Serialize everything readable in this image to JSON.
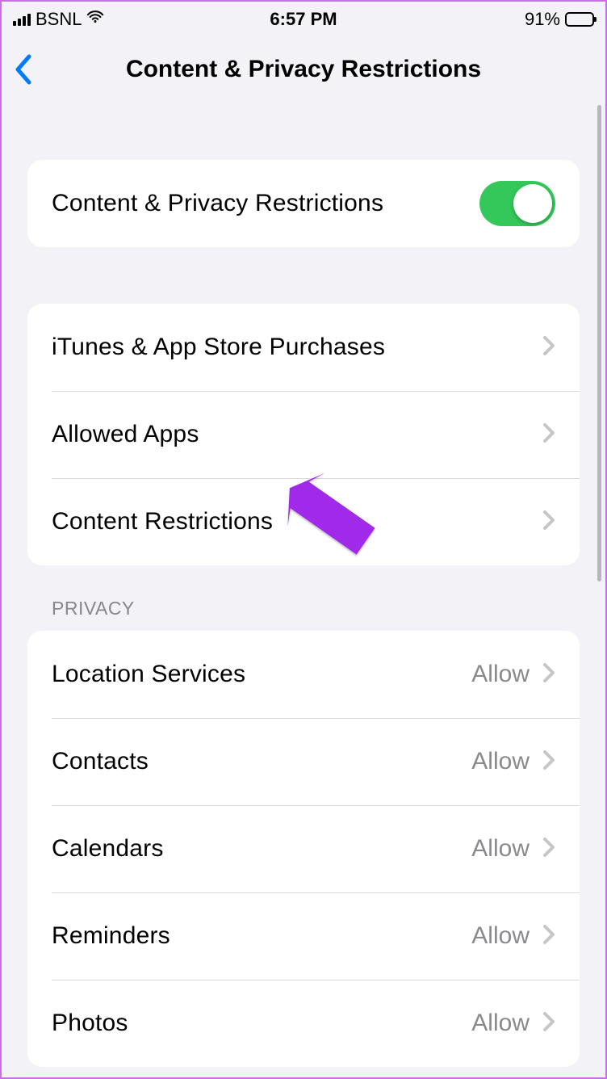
{
  "status_bar": {
    "carrier": "BSNL",
    "time": "6:57 PM",
    "battery_percent": "91%"
  },
  "nav": {
    "title": "Content & Privacy Restrictions"
  },
  "toggle_row": {
    "label": "Content & Privacy Restrictions",
    "on": true
  },
  "group2": {
    "items": [
      {
        "label": "iTunes & App Store Purchases"
      },
      {
        "label": "Allowed Apps"
      },
      {
        "label": "Content Restrictions"
      }
    ]
  },
  "privacy_section": {
    "header": "Privacy",
    "items": [
      {
        "label": "Location Services",
        "value": "Allow"
      },
      {
        "label": "Contacts",
        "value": "Allow"
      },
      {
        "label": "Calendars",
        "value": "Allow"
      },
      {
        "label": "Reminders",
        "value": "Allow"
      },
      {
        "label": "Photos",
        "value": "Allow"
      }
    ]
  },
  "annotation": {
    "arrow_color": "#a12bea"
  }
}
